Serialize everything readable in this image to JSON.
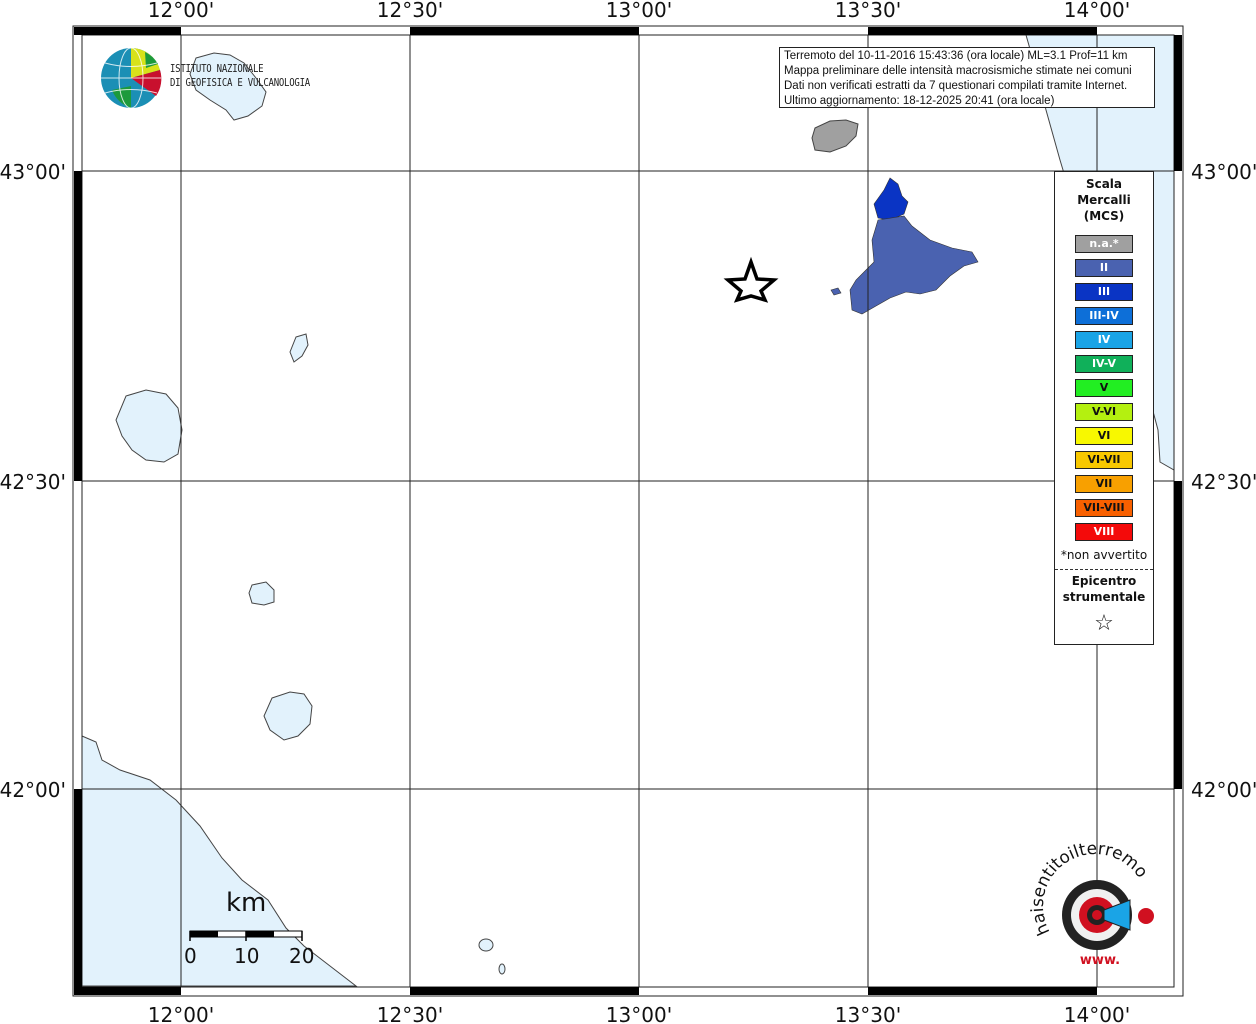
{
  "map": {
    "lon_ticks": [
      "12°00'",
      "12°30'",
      "13°00'",
      "13°30'",
      "14°00'"
    ],
    "lat_ticks": [
      "43°00'",
      "42°30'",
      "42°00'"
    ]
  },
  "institute": {
    "line1": "ISTITUTO NAZIONALE",
    "line2": "DI GEOFISICA E VULCANOLOGIA"
  },
  "info": {
    "line1": "Terremoto del 10-11-2016 15:43:36 (ora locale) ML=3.1 Prof=11 km",
    "line2": "Mappa preliminare delle intensità macrosismiche stimate nei comuni",
    "line3": "Dati non verificati estratti da 7 questionari compilati tramite Internet.",
    "line4": "Ultimo aggiornamento: 18-12-2025 20:41 (ora locale)"
  },
  "legend": {
    "title1": "Scala",
    "title2": "Mercalli",
    "title3": "(MCS)",
    "items": [
      {
        "label": "n.a.*",
        "color": "#a0a0a0"
      },
      {
        "label": "II",
        "color": "#4a62b0"
      },
      {
        "label": "III",
        "color": "#0a34c4"
      },
      {
        "label": "III-IV",
        "color": "#0d6fd8"
      },
      {
        "label": "IV",
        "color": "#1aa4e6"
      },
      {
        "label": "IV-V",
        "color": "#10b05a"
      },
      {
        "label": "V",
        "color": "#22ee22"
      },
      {
        "label": "V-VI",
        "color": "#b4f010"
      },
      {
        "label": "VI",
        "color": "#f8f800"
      },
      {
        "label": "VI-VII",
        "color": "#f8c800"
      },
      {
        "label": "VII",
        "color": "#f8a000"
      },
      {
        "label": "VII-VIII",
        "color": "#f86000"
      },
      {
        "label": "VIII",
        "color": "#f40a0a"
      }
    ],
    "note": "*non avvertito",
    "epi1": "Epicentro",
    "epi2": "strumentale",
    "star": "☆"
  },
  "scale": {
    "unit": "km",
    "labels": [
      "0",
      "10",
      "20"
    ]
  },
  "colors": {
    "sea": "#e2f2fc",
    "land": "#ffffff",
    "intensity_II": "#4a62b0",
    "intensity_III": "#0a34c4",
    "not_felt": "#a0a0a0"
  },
  "icons": {
    "ingv_logo": "globe-logo-icon",
    "epicenter": "star-icon",
    "hsit_logo": "haisentitoilterremoto-logo-icon"
  },
  "hsit_logo": {
    "ring_text": "haisentitoilterremoto.it",
    "bottom_text": "www."
  }
}
